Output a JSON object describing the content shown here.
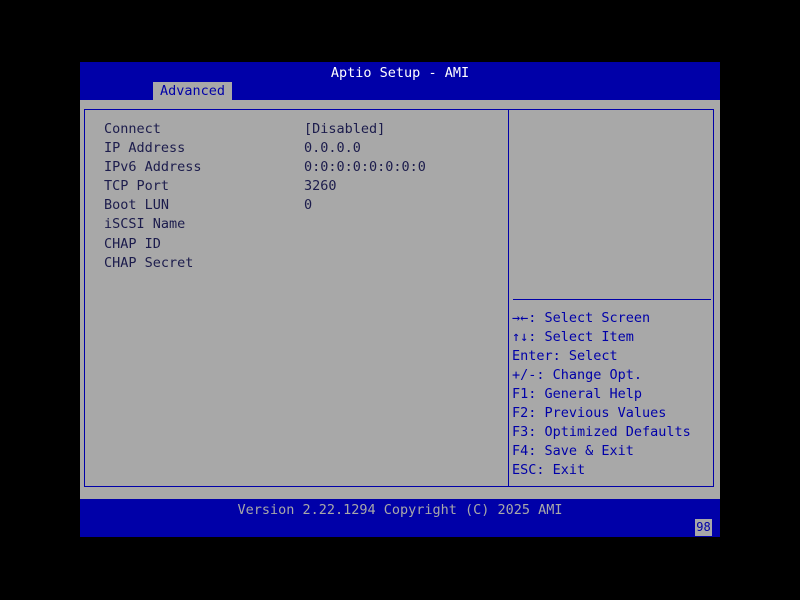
{
  "header": {
    "title": "Aptio Setup - AMI",
    "tabs": [
      {
        "label": "Advanced",
        "active": true
      }
    ]
  },
  "settings": [
    {
      "label": "Connect",
      "value": "[Disabled]"
    },
    {
      "label": "IP Address",
      "value": "0.0.0.0"
    },
    {
      "label": "IPv6 Address",
      "value": "0:0:0:0:0:0:0:0"
    },
    {
      "label": "TCP Port",
      "value": "3260"
    },
    {
      "label": "Boot LUN",
      "value": "0"
    },
    {
      "label": "iSCSI Name",
      "value": ""
    },
    {
      "label": "CHAP ID",
      "value": ""
    },
    {
      "label": "CHAP Secret",
      "value": ""
    }
  ],
  "help": [
    "→←: Select Screen",
    "↑↓: Select Item",
    "Enter: Select",
    "+/-: Change Opt.",
    "F1: General Help",
    "F2: Previous Values",
    "F3: Optimized Defaults",
    "F4: Save & Exit",
    "ESC: Exit"
  ],
  "footer": {
    "version": "Version 2.22.1294 Copyright (C) 2025 AMI",
    "postcode": "98"
  },
  "colors": {
    "background": "#000000",
    "panel": "#a8a8a8",
    "accent": "#0000a8",
    "text": "#1c1c4c"
  }
}
